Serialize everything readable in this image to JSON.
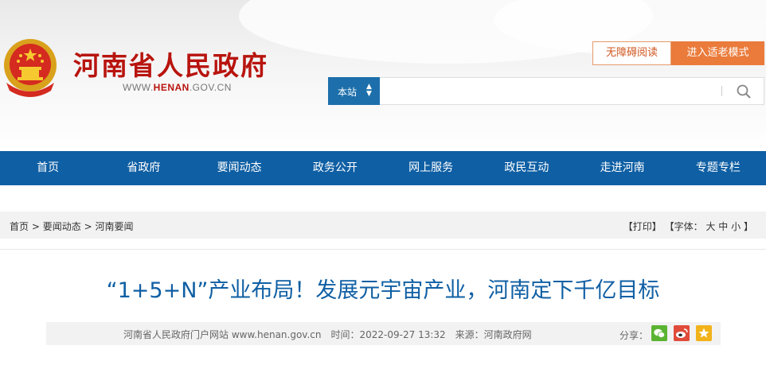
{
  "header": {
    "site_name": "河南省人民政府",
    "site_url_prefix": "WWW.",
    "site_url_brand": "HENAN",
    "site_url_suffix": ".GOV.CN",
    "accessible_reading_label": "无障碍阅读",
    "elderly_mode_label": "进入适老模式",
    "accent_color": "#b8140e"
  },
  "search": {
    "scope_label": "本站",
    "query": "",
    "placeholder": ""
  },
  "nav": {
    "items": [
      "首页",
      "省政府",
      "要闻动态",
      "政务公开",
      "网上服务",
      "政民互动",
      "走进河南",
      "专题专栏"
    ],
    "color": "#0f5fa4"
  },
  "breadcrumb": {
    "items": [
      "首页",
      "要闻动态",
      "河南要闻"
    ],
    "separator": ">"
  },
  "tools": {
    "print": "【打印】",
    "font_prefix": "【字体：",
    "font_large": "大",
    "font_medium": "中",
    "font_small": "小",
    "font_suffix": "】"
  },
  "article": {
    "title": "“1+5+N”产业布局！发展元宇宙产业，河南定下千亿目标",
    "publisher": "河南省人民政府门户网站 www.henan.gov.cn",
    "time_label": "时间：",
    "time": "2022-09-27 13:32",
    "source_label": "来源：",
    "source": "河南政府网",
    "share_label": "分享："
  },
  "icons": {
    "emblem": "national-emblem-icon",
    "search": "search-icon",
    "share": [
      "wechat-icon",
      "weibo-icon",
      "favorite-star-icon"
    ]
  }
}
